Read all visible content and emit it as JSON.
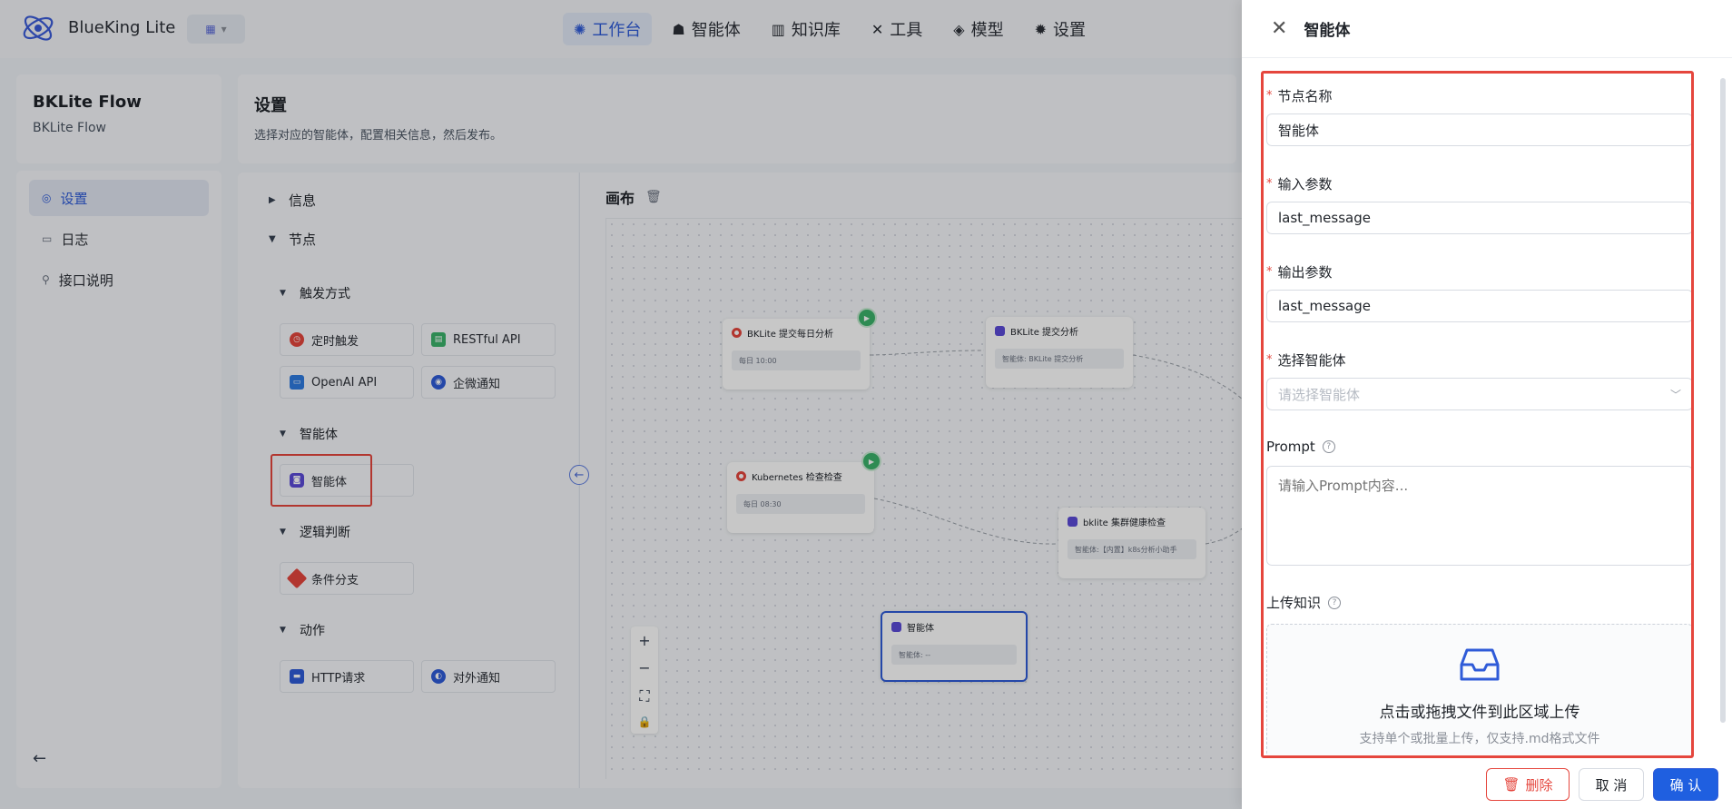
{
  "header": {
    "brand": "BlueKing Lite",
    "nav": [
      {
        "label": "工作台",
        "icon": "robot-icon",
        "active": true
      },
      {
        "label": "智能体",
        "icon": "agent-icon",
        "active": false
      },
      {
        "label": "知识库",
        "icon": "books-icon",
        "active": false
      },
      {
        "label": "工具",
        "icon": "tools-icon",
        "active": false
      },
      {
        "label": "模型",
        "icon": "layers-icon",
        "active": false
      },
      {
        "label": "设置",
        "icon": "gear-icon",
        "active": false
      }
    ]
  },
  "sidebar": {
    "title": "BKLite Flow",
    "subtitle": "BKLite Flow",
    "items": [
      {
        "label": "设置",
        "icon": "settings-icon",
        "active": true
      },
      {
        "label": "日志",
        "icon": "log-icon",
        "active": false
      },
      {
        "label": "接口说明",
        "icon": "link-icon",
        "active": false
      }
    ]
  },
  "main": {
    "title": "设置",
    "desc": "选择对应的智能体，配置相关信息，然后发布。"
  },
  "palette": {
    "section_info": "信息",
    "section_nodes": "节点",
    "trigger_title": "触发方式",
    "triggers": [
      {
        "label": "定时触发",
        "icon": "clock-icon",
        "color": "#e5463d"
      },
      {
        "label": "RESTful API",
        "icon": "api-icon",
        "color": "#3bb36b"
      },
      {
        "label": "OpenAI API",
        "icon": "openai-icon",
        "color": "#2f7be0"
      },
      {
        "label": "企微通知",
        "icon": "wecom-icon",
        "color": "#2f5bd8"
      }
    ],
    "agent_title": "智能体",
    "agent_item": {
      "label": "智能体",
      "icon": "agent-icon",
      "color": "#5b4bd8"
    },
    "logic_title": "逻辑判断",
    "logic_item": {
      "label": "条件分支",
      "icon": "branch-icon",
      "color": "#e5463d"
    },
    "action_title": "动作",
    "actions": [
      {
        "label": "HTTP请求",
        "icon": "http-icon",
        "color": "#2f5bd8"
      },
      {
        "label": "对外通知",
        "icon": "notify-icon",
        "color": "#2f5bd8"
      }
    ]
  },
  "canvas": {
    "title": "画布",
    "nodes": [
      {
        "title": "BKLite 提交每日分析",
        "body": "每日 10:00",
        "color": "#e5463d"
      },
      {
        "title": "BKLite 提交分析",
        "body": "智能体: BKLite 提交分析",
        "color": "#5b4bd8"
      },
      {
        "title": "Kubernetes 检查检查",
        "body": "每日 08:30",
        "color": "#e5463d"
      },
      {
        "title": "bklite 集群健康检查",
        "body": "智能体:【内置】k8s分析小助手",
        "color": "#5b4bd8"
      },
      {
        "title": "智能体",
        "body": "智能体: --",
        "color": "#5b4bd8"
      }
    ]
  },
  "drawer": {
    "title": "智能体",
    "fields": {
      "node_name_label": "节点名称",
      "node_name_value": "智能体",
      "input_label": "输入参数",
      "input_value": "last_message",
      "output_label": "输出参数",
      "output_value": "last_message",
      "agent_label": "选择智能体",
      "agent_placeholder": "请选择智能体",
      "prompt_label": "Prompt",
      "prompt_placeholder": "请输入Prompt内容...",
      "upload_label": "上传知识",
      "upload_main": "点击或拖拽文件到此区域上传",
      "upload_sub": "支持单个或批量上传，仅支持.md格式文件"
    },
    "buttons": {
      "delete": "删除",
      "cancel": "取 消",
      "confirm": "确 认"
    }
  }
}
